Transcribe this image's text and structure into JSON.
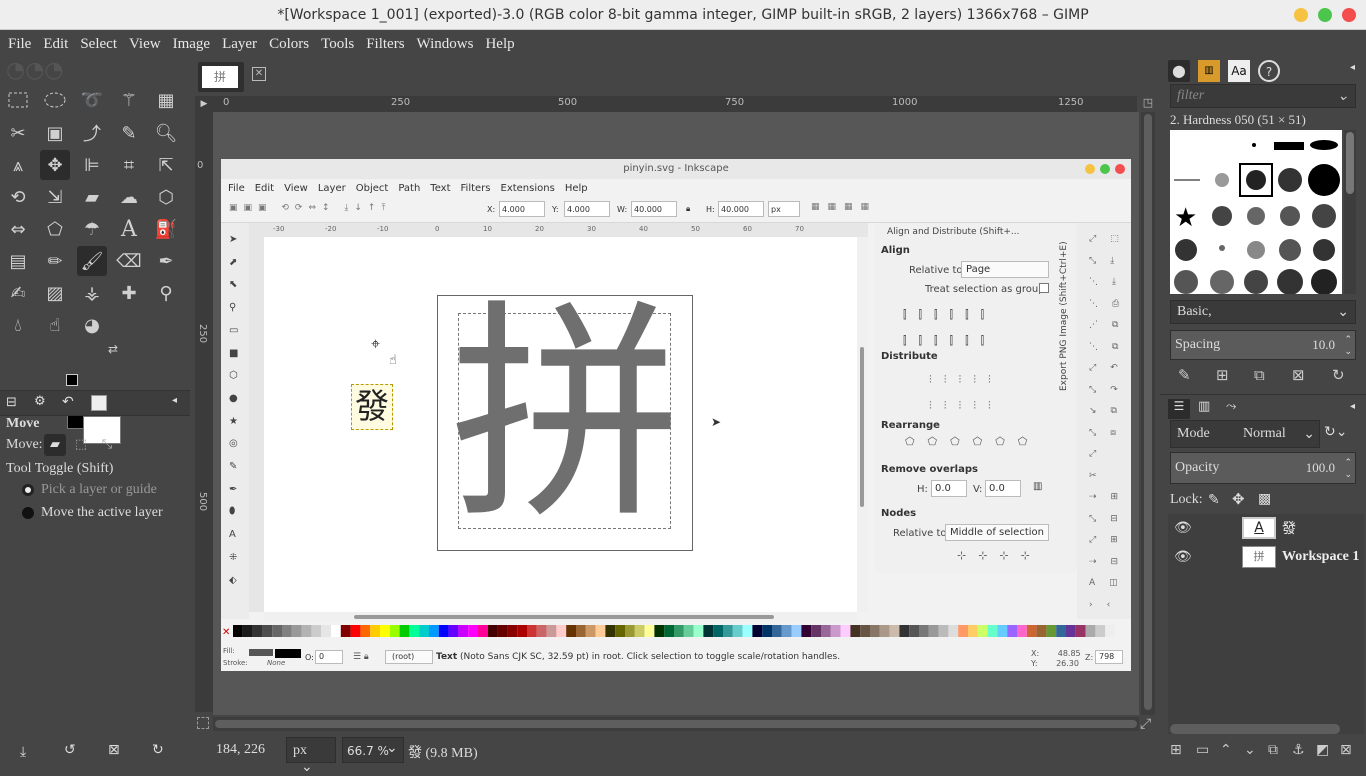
{
  "window": {
    "title": "*[Workspace 1_001] (exported)-3.0 (RGB color 8-bit gamma integer, GIMP built-in sRGB, 2 layers) 1366x768 – GIMP"
  },
  "menu": [
    "File",
    "Edit",
    "Select",
    "View",
    "Image",
    "Layer",
    "Colors",
    "Tools",
    "Filters",
    "Windows",
    "Help"
  ],
  "image_tab": {
    "thumb_char": "拼"
  },
  "ruler_top": [
    "0",
    "250",
    "500",
    "750",
    "1000",
    "1250"
  ],
  "ruler_left": [
    "0",
    "250",
    "500"
  ],
  "tool_options": {
    "title": "Move",
    "move_label": "Move:",
    "toggle_label": "Tool Toggle  (Shift)",
    "option1": "Pick a layer or guide",
    "option2": "Move the active layer"
  },
  "status": {
    "coords": "184, 226",
    "unit": "px",
    "zoom": "66.7 %",
    "info": "發 (9.8 MB)"
  },
  "inkscape": {
    "title": "pinyin.svg - Inkscape",
    "menu": [
      "File",
      "Edit",
      "View",
      "Layer",
      "Object",
      "Path",
      "Text",
      "Filters",
      "Extensions",
      "Help"
    ],
    "x_label": "X:",
    "x_value": "4.000",
    "y_label": "Y:",
    "y_value": "4.000",
    "w_label": "W:",
    "w_value": "40.000",
    "h_label": "H:",
    "h_value": "40.000",
    "unit": "px",
    "ruler": [
      "-30",
      "-20",
      "-10",
      "0",
      "10",
      "20",
      "30",
      "40",
      "50",
      "60",
      "70"
    ],
    "big_char": "拼",
    "small_char": "發",
    "panel": {
      "title": "Align and Distribute (Shift+...",
      "align": "Align",
      "relative_to_label": "Relative to:",
      "relative_to_value": "Page",
      "treat_group": "Treat selection as group:",
      "distribute": "Distribute",
      "rearrange": "Rearrange",
      "remove_overlaps": "Remove overlaps",
      "h_label": "H:",
      "h_value": "0.0",
      "v_label": "V:",
      "v_value": "0.0",
      "nodes": "Nodes",
      "nodes_relative_label": "Relative to:",
      "nodes_relative_value": "Middle of selection",
      "export_tab": "Export PNG Image (Shift+Ctrl+E)"
    },
    "status": {
      "fill_label": "Fill:",
      "stroke_label": "Stroke:",
      "stroke_value": "None",
      "opacity_label": "O:",
      "opacity_value": "0",
      "layer": "(root)",
      "message_bold": "Text",
      "message": " (Noto Sans CJK SC, 32.59 pt) in root. Click selection to toggle scale/rotation handles.",
      "x_label": "X:",
      "x_value": "48.85",
      "y_label": "Y:",
      "y_value": "26.30",
      "z_label": "Z:",
      "z_value": "798"
    }
  },
  "brushes": {
    "filter_placeholder": "filter",
    "brush_name": "2. Hardness 050 (51 × 51)",
    "preset": "Basic,",
    "spacing_label": "Spacing",
    "spacing_value": "10.0"
  },
  "layers": {
    "mode_label": "Mode",
    "mode_value": "Normal",
    "opacity_label": "Opacity",
    "opacity_value": "100.0",
    "lock_label": "Lock:",
    "items": [
      {
        "name": "發",
        "thumb": "A"
      },
      {
        "name": "Workspace 1",
        "thumb": "拼"
      }
    ]
  },
  "colors": {
    "gimp_bg": "#454545",
    "fg_color": "#000000",
    "bg_color": "#ffffff",
    "glyph_gray": "#6f6f6f",
    "close_red": "#f44d4d",
    "min_yellow": "#f5c242",
    "max_green": "#4cc54c"
  }
}
